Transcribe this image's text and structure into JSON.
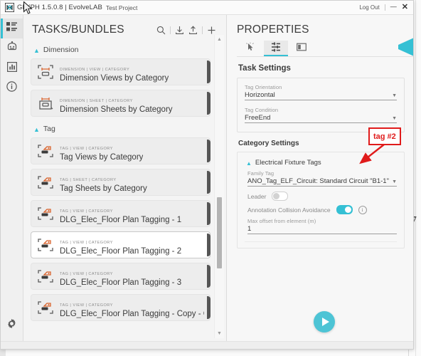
{
  "background": {
    "page_number": "7"
  },
  "titlebar": {
    "app_title": "GLYPH 1.5.0.8 | EvolveLAB",
    "project": "Test Project",
    "logout": "Log Out",
    "minimize": "—",
    "close": "✕",
    "logo_icon": "glyph-logo-icon"
  },
  "rail": {
    "items": [
      {
        "name": "tasks-list",
        "icon": "list-icon",
        "active": true
      },
      {
        "name": "bot",
        "icon": "robot-icon",
        "active": false
      },
      {
        "name": "analytics",
        "icon": "bar-chart-icon",
        "active": false
      },
      {
        "name": "info",
        "icon": "info-circle-icon",
        "active": false
      }
    ],
    "settings": {
      "name": "settings",
      "icon": "gear-icon"
    }
  },
  "tasks": {
    "title": "TASKS/BUNDLES",
    "actions": [
      {
        "name": "search",
        "icon": "search-icon"
      },
      {
        "name": "import",
        "icon": "download-icon"
      },
      {
        "name": "export",
        "icon": "upload-icon"
      },
      {
        "name": "add",
        "icon": "plus-icon"
      }
    ],
    "groups": [
      {
        "label": "Dimension",
        "expanded": true,
        "items": [
          {
            "crumb": "DIMENSION | VIEW | CATEGORY",
            "title": "Dimension Views by Category",
            "icon": "dimension-view-icon",
            "selected": false
          },
          {
            "crumb": "DIMENSION | SHEET | CATEGORY",
            "title": "Dimension Sheets by Category",
            "icon": "dimension-sheet-icon",
            "selected": false
          }
        ]
      },
      {
        "label": "Tag",
        "expanded": true,
        "items": [
          {
            "crumb": "TAG | VIEW | CATEGORY",
            "title": "Tag Views by Category",
            "icon": "tag-view-icon",
            "selected": false
          },
          {
            "crumb": "TAG | SHEET | CATEGORY",
            "title": "Tag Sheets by Category",
            "icon": "tag-sheet-icon",
            "selected": false
          },
          {
            "crumb": "TAG | VIEW | CATEGORY",
            "title": "DLG_Elec_Floor Plan Tagging - 1",
            "icon": "tag-view-icon",
            "selected": false
          },
          {
            "crumb": "TAG | VIEW | CATEGORY",
            "title": "DLG_Elec_Floor Plan Tagging - 2",
            "icon": "tag-view-icon",
            "selected": true
          },
          {
            "crumb": "TAG | VIEW | CATEGORY",
            "title": "DLG_Elec_Floor Plan Tagging - 3",
            "icon": "tag-view-icon",
            "selected": false
          },
          {
            "crumb": "TAG | VIEW | CATEGORY",
            "title": "DLG_Elec_Floor Plan Tagging - Copy - Copy",
            "icon": "tag-view-icon",
            "selected": false
          }
        ]
      }
    ],
    "scrollbar": {
      "up": "▲",
      "down": "▼"
    }
  },
  "properties": {
    "title": "PROPERTIES",
    "tabs": [
      {
        "name": "selection",
        "icon": "cursor-click-icon",
        "active": false
      },
      {
        "name": "settings",
        "icon": "sliders-icon",
        "active": true
      },
      {
        "name": "layout",
        "icon": "panel-layout-icon",
        "active": false
      }
    ],
    "task_settings": {
      "heading": "Task Settings",
      "tag_orientation": {
        "label": "Tag Orientation",
        "value": "Horizontal"
      },
      "tag_condition": {
        "label": "Tag Condition",
        "value": "FreeEnd"
      }
    },
    "category_settings": {
      "heading": "Category Settings",
      "group": "Electrical Fixture Tags",
      "family_tag": {
        "label": "Family Tag",
        "value": "ANO_Tag_ELF_Circuit: Standard Circuit \"B1-1\""
      },
      "leader": {
        "label": "Leader",
        "on": false
      },
      "collision": {
        "label": "Annotation Collision Avoidance",
        "on": true,
        "info_icon": "info-circle-icon"
      },
      "max_offset": {
        "label": "Max offset from element (m)",
        "value": "1"
      }
    },
    "run_button": {
      "name": "run-button",
      "icon": "play-icon"
    },
    "side_tab": {
      "name": "collapse-panel-tab",
      "icon": "chevron-left-tab-icon"
    }
  },
  "annotation": {
    "label": "tag #2",
    "color": "#e01b1b"
  },
  "colors": {
    "accent_teal": "#35c0d4",
    "accent_orange": "#d9622b",
    "panel_bg": "#f4f4f4",
    "annotation_red": "#e01b1b"
  }
}
